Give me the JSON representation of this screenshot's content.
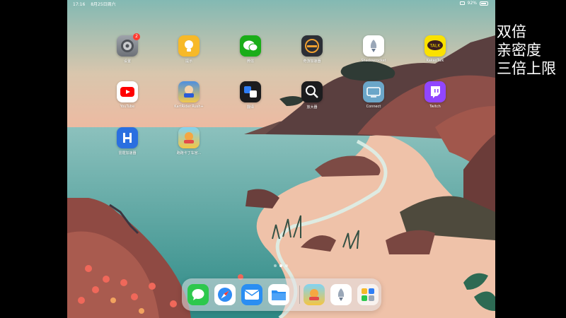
{
  "status_bar": {
    "time": "17:16",
    "date": "8月25日周六",
    "battery": "92%"
  },
  "apps": [
    {
      "id": "settings",
      "label": "设置",
      "badge": "2"
    },
    {
      "id": "tips",
      "label": "提示",
      "badge": ""
    },
    {
      "id": "wechat",
      "label": "微信",
      "badge": ""
    },
    {
      "id": "accelerator",
      "label": "奇游加速器",
      "badge": ""
    },
    {
      "id": "shadowrocket",
      "label": "Shadowrocket",
      "badge": ""
    },
    {
      "id": "kakaotalk",
      "label": "KakaoTalk",
      "badge": ""
    },
    {
      "id": "youtube",
      "label": "YouTube",
      "badge": ""
    },
    {
      "id": "kartrider",
      "label": "KartRider Rush+",
      "badge": ""
    },
    {
      "id": "translate",
      "label": "翻译",
      "badge": ""
    },
    {
      "id": "magnifier",
      "label": "放大器",
      "badge": ""
    },
    {
      "id": "connect",
      "label": "Connect",
      "badge": ""
    },
    {
      "id": "twitch",
      "label": "Twitch",
      "badge": ""
    },
    {
      "id": "booster",
      "label": "雷霆加速器",
      "badge": ""
    },
    {
      "id": "kart_cn",
      "label": "跑跑卡丁车官...",
      "badge": ""
    }
  ],
  "icons": {
    "settings": "gear-icon",
    "tips": "lightbulb-icon",
    "wechat": "chat-bubbles-icon",
    "accelerator": "speedometer-icon",
    "shadowrocket": "rocket-icon",
    "kakaotalk": "talk-bubble-icon",
    "youtube": "play-icon",
    "kartrider": "kart-character-icon",
    "translate": "translate-icon",
    "magnifier": "magnifier-icon",
    "connect": "tv-icon",
    "twitch": "twitch-icon",
    "booster": "booster-icon",
    "kart_cn": "kart-character-icon"
  },
  "dock": {
    "apps": [
      {
        "id": "messages",
        "icon": "message-bubble-icon"
      },
      {
        "id": "safari",
        "icon": "compass-icon"
      },
      {
        "id": "mail",
        "icon": "envelope-icon"
      },
      {
        "id": "files",
        "icon": "folder-icon"
      },
      {
        "id": "kart_recent",
        "icon": "kart-character-icon"
      },
      {
        "id": "shadowrocket_recent",
        "icon": "rocket-icon"
      },
      {
        "id": "app_library",
        "icon": "app-grid-icon"
      }
    ]
  },
  "page_indicator": {
    "count": 3,
    "current": 2
  },
  "overlay_text": [
    "双倍",
    "亲密度",
    "三倍上限"
  ],
  "colors": {
    "badge": "#ff3b30",
    "youtube": "#ff0000",
    "wechat": "#1aad19",
    "twitch": "#9146ff",
    "kakao": "#fae100"
  }
}
